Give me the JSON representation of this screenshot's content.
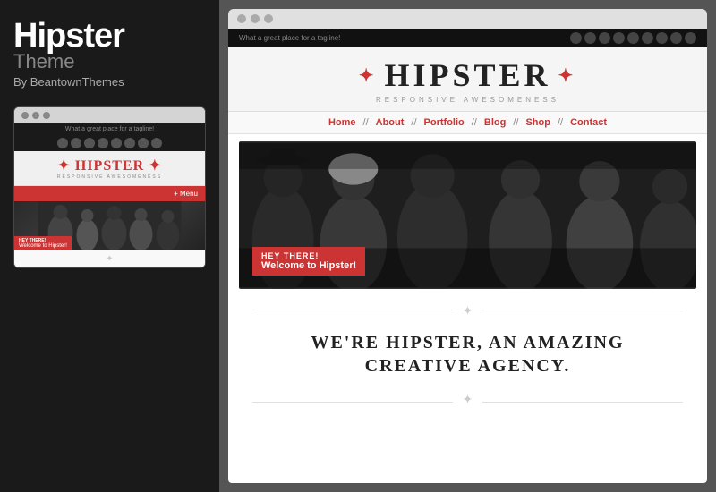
{
  "sidebar": {
    "title": "Hipster",
    "subtitle": "Theme",
    "author": "By BeantownThemes"
  },
  "mini_preview": {
    "tagline": "What a great place for a tagline!",
    "logo_stars": "✦",
    "logo_text": "HIPSTER",
    "logo_sub": "RESPONSIVE AWESOMENESS",
    "menu_btn": "+ Menu",
    "hero_tag1": "HEY THERE!",
    "hero_tag2": "Welcome to Hipster!"
  },
  "main_preview": {
    "tagline": "What a great place for a tagline!",
    "logo_star_left": "✦",
    "logo_text": "HIPSTER",
    "logo_star_right": "✦",
    "logo_sub": "RESPONSIVE AWESOMENESS",
    "nav_items": [
      "Home",
      "About",
      "Portfolio",
      "Blog",
      "Shop",
      "Contact"
    ],
    "hero_tag1": "HEY THERE!",
    "hero_tag2": "Welcome to Hipster!",
    "star_icon": "✦",
    "agency_line1": "WE'RE HIPSTER, AN AMAZING",
    "agency_line2": "CREATIVE AGENCY."
  },
  "colors": {
    "red": "#cc3333",
    "dark": "#1a1a1a",
    "light_gray": "#f5f5f5"
  }
}
